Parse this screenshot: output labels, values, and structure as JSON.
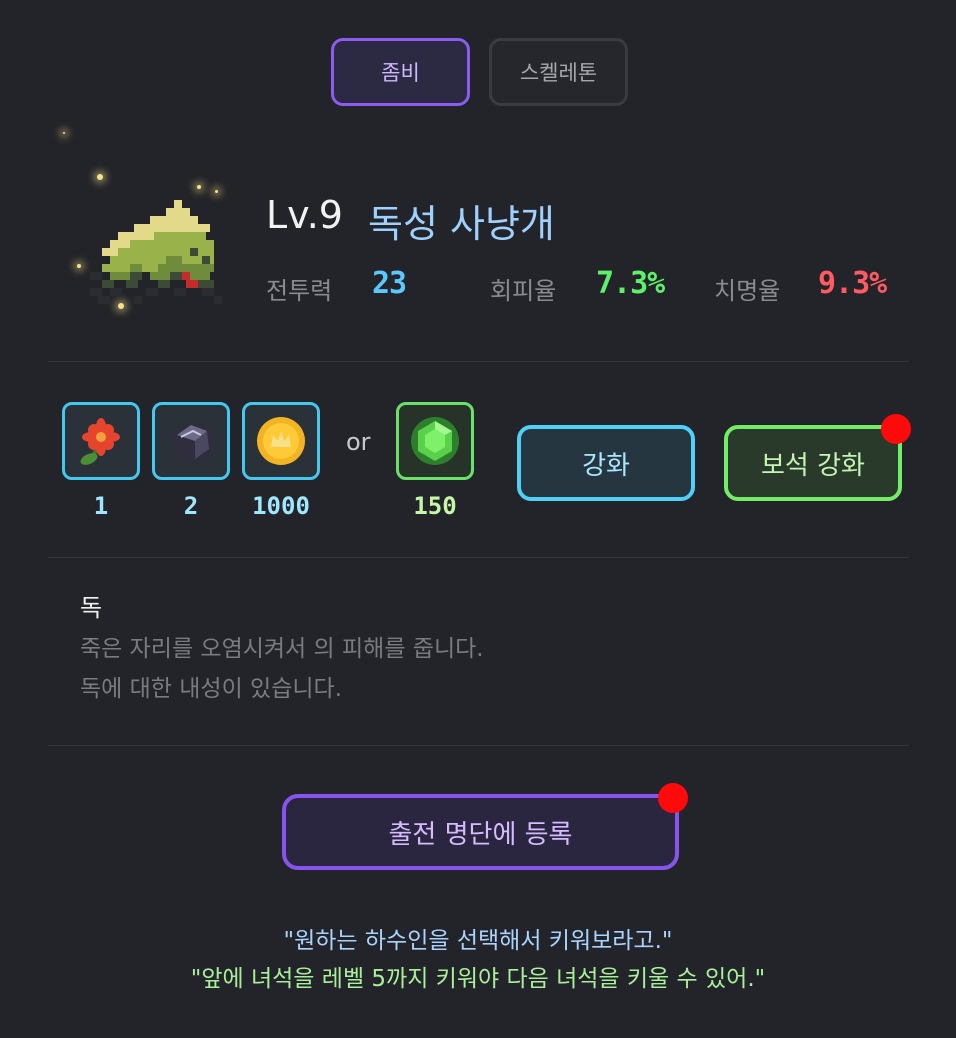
{
  "tabs": {
    "zombie": "좀비",
    "skeleton": "스켈레톤",
    "active": "zombie"
  },
  "monster": {
    "level": "Lv.9",
    "name": "독성 사냥개",
    "sprite_icon": "zombie-hound-icon"
  },
  "stats": {
    "power_label": "전투력",
    "power_value": "23",
    "evasion_label": "회피율",
    "evasion_value": "7.3%",
    "crit_label": "치명율",
    "crit_value": "9.3%"
  },
  "materials": {
    "items": [
      {
        "icon": "red-flower-icon",
        "count": "1"
      },
      {
        "icon": "dark-ore-icon",
        "count": "2"
      },
      {
        "icon": "gold-coin-icon",
        "count": "1000"
      }
    ],
    "or_label": "or",
    "gem": {
      "icon": "green-gem-icon",
      "count": "150"
    }
  },
  "buttons": {
    "upgrade": "강화",
    "gem_upgrade": "보석 강화",
    "register": "출전 명단에 등록"
  },
  "description": {
    "title": "독",
    "line1": "죽은 자리를 오염시켜서 의 피해를 줍니다.",
    "line2": "독에 대한 내성이 있습니다."
  },
  "quotes": {
    "line1": "\"원하는 하수인을 선택해서 키워보라고.\"",
    "line2": "\"앞에 녀석을 레벨 5까지 키워야 다음 녀석을 키울 수 있어.\""
  },
  "colors": {
    "background": "#232429",
    "accent_purple": "#8a5cf0",
    "accent_cyan": "#4fd0f6",
    "accent_green": "#73ed66",
    "stat_power": "#5cc6ff",
    "stat_evasion": "#5df06a",
    "stat_crit": "#ff5a62",
    "badge_red": "#ff0a0a"
  }
}
